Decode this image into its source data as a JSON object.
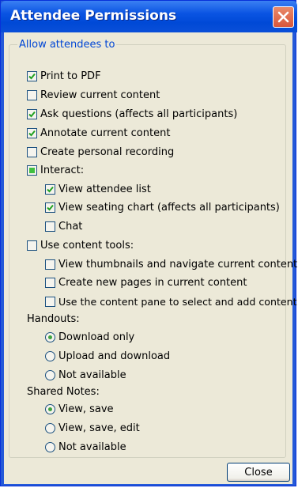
{
  "window": {
    "title": "Attendee Permissions"
  },
  "group": {
    "legend": "Allow attendees to"
  },
  "items": {
    "print_pdf": {
      "label": "Print to PDF",
      "checked": true
    },
    "review_content": {
      "label": "Review current content",
      "checked": false
    },
    "ask_questions": {
      "label": "Ask questions (affects all participants)",
      "checked": true
    },
    "annotate": {
      "label": "Annotate current content",
      "checked": true
    },
    "personal_recording": {
      "label": "Create personal recording",
      "checked": false
    },
    "interact": {
      "label": "Interact:",
      "state": "partial"
    },
    "view_attendee_list": {
      "label": "View attendee list",
      "checked": true
    },
    "view_seating_chart": {
      "label": "View seating chart (affects all participants)",
      "checked": true
    },
    "chat": {
      "label": "Chat",
      "checked": false
    },
    "use_content_tools": {
      "label": "Use content tools:",
      "checked": false
    },
    "view_thumbnails": {
      "label": "View thumbnails and navigate current content",
      "checked": false
    },
    "create_pages": {
      "label": "Create new pages in current content",
      "checked": false
    },
    "use_content_pane": {
      "label": "Use the content pane to select and add content",
      "checked": false
    }
  },
  "handouts": {
    "label": "Handouts:",
    "options": [
      "Download only",
      "Upload and download",
      "Not available"
    ],
    "selected": "Download only"
  },
  "shared_notes": {
    "label": "Shared Notes:",
    "options": [
      "View, save",
      "View, save, edit",
      "Not available"
    ],
    "selected": "View, save"
  },
  "buttons": {
    "close": "Close"
  },
  "colors": {
    "title_bar": "#0a54e3",
    "legend_text": "#0046d5",
    "check_mark": "#21a121",
    "panel_bg": "#ece9d8"
  }
}
